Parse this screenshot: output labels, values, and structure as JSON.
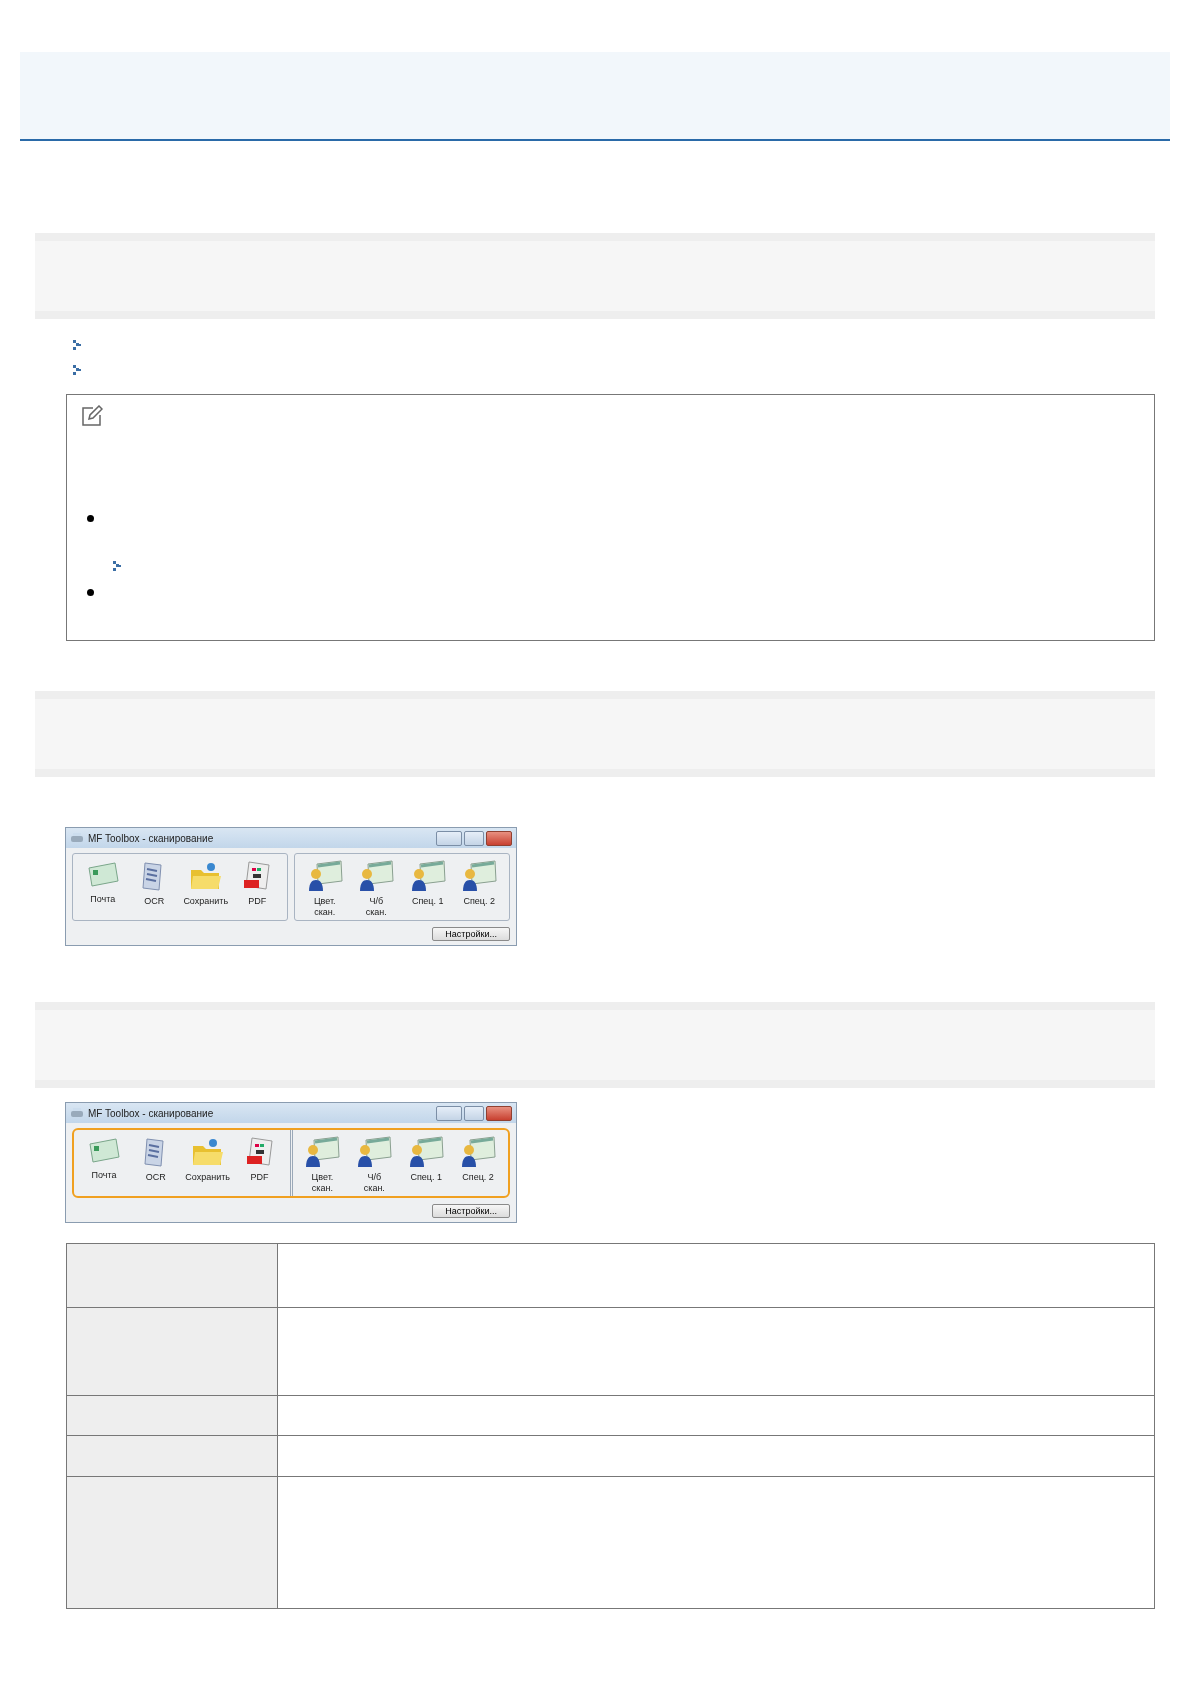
{
  "toolbox_windows": [
    {
      "title": "MF Toolbox - сканирование",
      "highlighted": false,
      "groups": [
        [
          {
            "kind": "mail",
            "label": "Почта"
          },
          {
            "kind": "ocr",
            "label": "OCR"
          },
          {
            "kind": "folder",
            "label": "Сохранить"
          },
          {
            "kind": "pdf",
            "label": "PDF"
          }
        ],
        [
          {
            "kind": "scan",
            "label": "Цвет.\nскан."
          },
          {
            "kind": "scan",
            "label": "Ч/б\nскан."
          },
          {
            "kind": "scan",
            "label": "Спец. 1"
          },
          {
            "kind": "scan",
            "label": "Спец. 2"
          }
        ]
      ],
      "settings_button": "Настройки..."
    },
    {
      "title": "MF Toolbox - сканирование",
      "highlighted": true,
      "groups": [
        [
          {
            "kind": "mail",
            "label": "Почта"
          },
          {
            "kind": "ocr",
            "label": "OCR"
          },
          {
            "kind": "folder",
            "label": "Сохранить"
          },
          {
            "kind": "pdf",
            "label": "PDF"
          }
        ],
        [
          {
            "kind": "scan",
            "label": "Цвет.\nскан."
          },
          {
            "kind": "scan",
            "label": "Ч/б\nскан."
          },
          {
            "kind": "scan",
            "label": "Спец. 1"
          },
          {
            "kind": "scan",
            "label": "Спец. 2"
          }
        ]
      ],
      "settings_button": "Настройки..."
    }
  ]
}
